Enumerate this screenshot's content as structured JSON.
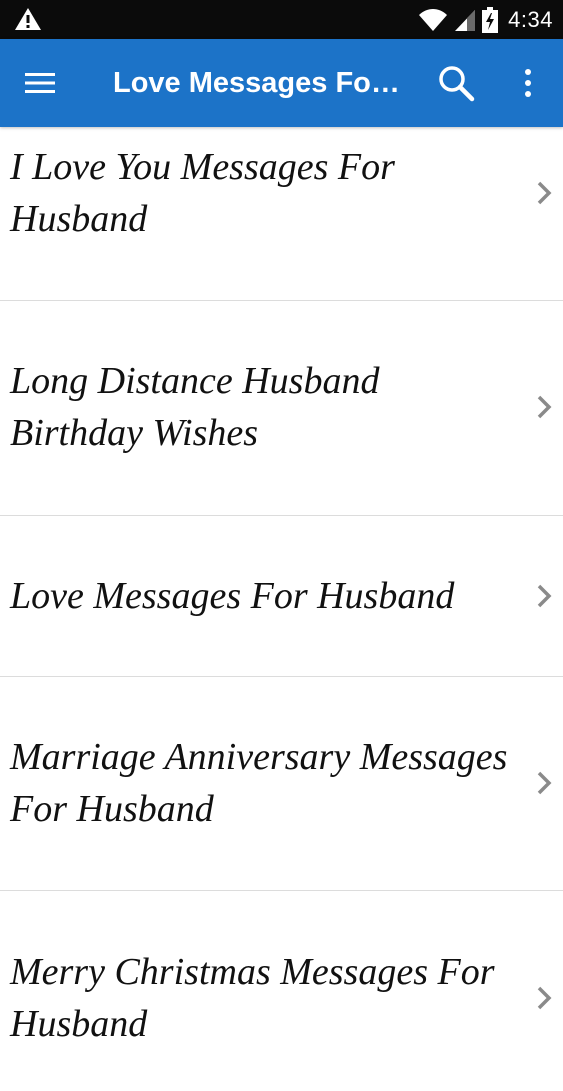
{
  "status_bar": {
    "time": "4:34",
    "icons": [
      "warning-icon",
      "wifi-icon",
      "signal-icon",
      "battery-icon"
    ]
  },
  "app_bar": {
    "title": "Love Messages For Husband",
    "icons": [
      "menu-icon",
      "search-icon",
      "more-vert-icon"
    ],
    "color": "#1c73c8"
  },
  "list": {
    "items": [
      {
        "label": "I Love You Messages For Husband"
      },
      {
        "label": "Long Distance Husband Birthday Wishes"
      },
      {
        "label": "Love Messages For Husband"
      },
      {
        "label": "Marriage Anniversary Messages For Husband"
      },
      {
        "label": "Merry Christmas Messages For Husband"
      }
    ],
    "chevron_icon": "chevron-right-icon"
  }
}
